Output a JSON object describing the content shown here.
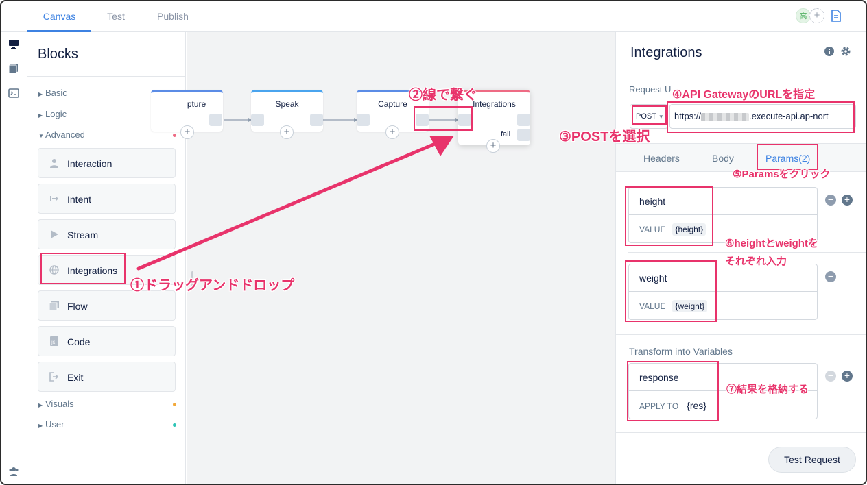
{
  "tabs": [
    {
      "label": "Canvas",
      "active": true
    },
    {
      "label": "Test",
      "active": false
    },
    {
      "label": "Publish",
      "active": false
    }
  ],
  "topbar": {
    "avatar_text": "高",
    "add_symbol": "+"
  },
  "blocks": {
    "title": "Blocks",
    "categories": [
      {
        "label": "Basic",
        "color": "#3d82e2"
      },
      {
        "label": "Logic",
        "color": "#5b6ee8"
      },
      {
        "label": "Advanced",
        "color": "#ee6b84"
      },
      {
        "label": "Visuals",
        "color": "#f2a93b"
      },
      {
        "label": "User",
        "color": "#2ec4b6"
      }
    ],
    "items": [
      {
        "label": "Interaction",
        "icon": "person-icon"
      },
      {
        "label": "Intent",
        "icon": "arrow-in-icon"
      },
      {
        "label": "Stream",
        "icon": "play-icon"
      },
      {
        "label": "Integrations",
        "icon": "globe-icon"
      },
      {
        "label": "Flow",
        "icon": "stack-icon"
      },
      {
        "label": "Code",
        "icon": "js-file-icon"
      },
      {
        "label": "Exit",
        "icon": "exit-icon"
      }
    ]
  },
  "canvas": {
    "nodes": [
      {
        "title": "pture",
        "color": "#5b8ce6"
      },
      {
        "title": "Speak",
        "color": "#4aa4ee"
      },
      {
        "title": "Capture",
        "color": "#5b8ce6"
      },
      {
        "title": "Integrations",
        "color": "#ee6b84"
      }
    ],
    "fail_label": "fail",
    "plus": "+"
  },
  "panel": {
    "title": "Integrations",
    "request_url_label": "Request U",
    "method": "POST",
    "url_prefix": "https://",
    "url_suffix": ".execute-api.ap-nort",
    "subtabs": [
      {
        "label": "Headers",
        "active": false
      },
      {
        "label": "Body",
        "active": false
      },
      {
        "label": "Params(2)",
        "active": true
      }
    ],
    "params": [
      {
        "key": "height",
        "value_label": "VALUE",
        "value": "{height}"
      },
      {
        "key": "weight",
        "value_label": "VALUE",
        "value": "{weight}"
      }
    ],
    "transform_label": "Transform into Variables",
    "transform": {
      "key": "response",
      "apply_label": "APPLY TO",
      "value": "{res}"
    },
    "test_button": "Test Request"
  },
  "annotations": {
    "a1": "①ドラッグアンドドロップ",
    "a2": "②線で繋ぐ",
    "a3": "③POSTを選択",
    "a4": "④API GatewayのURLを指定",
    "a5": "⑤Paramsをクリック",
    "a6_line1": "⑥heightとweightを",
    "a6_line2": "それぞれ入力",
    "a7": "⑦結果を格納する",
    "color": "#e8336b"
  }
}
